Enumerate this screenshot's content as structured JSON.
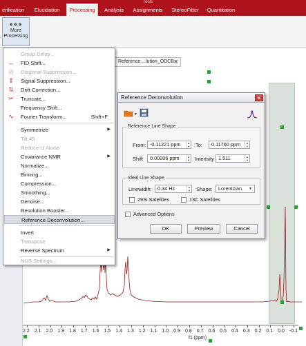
{
  "ribbon": {
    "tabs": [
      "erification",
      "Elucidation",
      "Processing",
      "Analysis",
      "Assignments",
      "StereoFitter",
      "Quantitation"
    ],
    "active_tab": "Processing",
    "context_fragment": "Tools",
    "more_processing_label": "More Processing"
  },
  "document_tab": {
    "title": "Reference ...lution_ODCB"
  },
  "menu": {
    "items": [
      {
        "label": "Group Delay...",
        "disabled": true
      },
      {
        "label": "FID Shift...",
        "disabled": false
      },
      {
        "label": "Diagonal Suppression...",
        "disabled": true
      },
      {
        "label": "Signal Suppression...",
        "disabled": false
      },
      {
        "label": "Drift Correction...",
        "disabled": false
      },
      {
        "label": "Truncate...",
        "disabled": false
      },
      {
        "label": "Frequency Shift...",
        "disabled": false
      },
      {
        "label": "Fourier Transform...",
        "shortcut": "Shift+F",
        "disabled": false
      },
      {
        "label": "Symmetrize",
        "disabled": false,
        "submenu": true
      },
      {
        "label": "Tilt 45",
        "disabled": true
      },
      {
        "label": "Reduce t1 Noise",
        "disabled": true
      },
      {
        "label": "Covariance NMR",
        "disabled": false,
        "submenu": true
      },
      {
        "label": "Normalize...",
        "disabled": false
      },
      {
        "label": "Binning...",
        "disabled": false
      },
      {
        "label": "Compression...",
        "disabled": false
      },
      {
        "label": "Smoothing...",
        "disabled": false
      },
      {
        "label": "Denoise...",
        "disabled": false
      },
      {
        "label": "Resolution Booster...",
        "disabled": false
      },
      {
        "label": "Reference Deconvolution...",
        "disabled": false,
        "highlighted": true
      },
      {
        "label": "Invert",
        "disabled": false
      },
      {
        "label": "Transpose",
        "disabled": true
      },
      {
        "label": "Reverse Spectrum",
        "disabled": false,
        "submenu": true
      },
      {
        "label": "NUS Settings...",
        "disabled": true
      }
    ]
  },
  "dialog": {
    "title": "Reference Deconvolution",
    "reference_group": "Reference Line Shape",
    "from_label": "From:",
    "from_value": "-0.11221 ppm",
    "to_label": "To:",
    "to_value": "0.11760 ppm",
    "shift_label": "Shift",
    "shift_value": "0.00006 ppm",
    "intensity_label": "Intensity",
    "intensity_value": "1.511",
    "ideal_group": "Ideal Line Shape",
    "linewidth_label": "Linewidth:",
    "linewidth_value": "0.34 Hz",
    "shape_label": "Shape:",
    "shape_value": "Lorentzian",
    "si_label": "29Si Satellites",
    "c_label": "13C Satellites",
    "advanced_label": "Advanced Options",
    "ok": "OK",
    "preview": "Preview",
    "cancel": "Cancel"
  },
  "axis": {
    "ticks": [
      "2.2",
      "2.1",
      "2.0",
      "1.9",
      "1.8",
      "1.7",
      "1.6",
      "1.5",
      "1.4",
      "1.3",
      "1.2",
      "1.1",
      "1.0",
      "0.9",
      "0.8",
      "0.7",
      "0.6",
      "0.5",
      "0.4",
      "0.3",
      "0.2",
      "0.1",
      "0.0",
      "-0.1"
    ],
    "label": "f1 (ppm)"
  },
  "colors": {
    "brand": "#b0121c",
    "spectrum": "#8b1a1a",
    "handle": "#2e9c3a"
  }
}
